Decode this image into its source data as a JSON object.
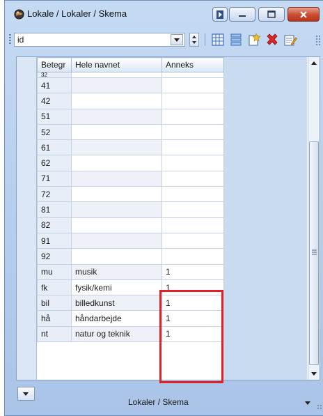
{
  "window": {
    "title": "Lokale / Lokaler / Skema"
  },
  "toolbar": {
    "field_value": "id",
    "icons": [
      "grid-icon",
      "list-icon",
      "new-record-icon",
      "delete-icon",
      "edit-icon"
    ]
  },
  "grid": {
    "columns": [
      "Betegr",
      "Hele navnet",
      "Anneks"
    ],
    "partial_row_code": "32",
    "rows": [
      {
        "code": "41",
        "name": "",
        "annex": ""
      },
      {
        "code": "42",
        "name": "",
        "annex": ""
      },
      {
        "code": "51",
        "name": "",
        "annex": ""
      },
      {
        "code": "52",
        "name": "",
        "annex": ""
      },
      {
        "code": "61",
        "name": "",
        "annex": ""
      },
      {
        "code": "62",
        "name": "",
        "annex": ""
      },
      {
        "code": "71",
        "name": "",
        "annex": ""
      },
      {
        "code": "72",
        "name": "",
        "annex": ""
      },
      {
        "code": "81",
        "name": "",
        "annex": ""
      },
      {
        "code": "82",
        "name": "",
        "annex": ""
      },
      {
        "code": "91",
        "name": "",
        "annex": ""
      },
      {
        "code": "92",
        "name": "",
        "annex": ""
      },
      {
        "code": "mu",
        "name": "musik",
        "annex": "1"
      },
      {
        "code": "fk",
        "name": "fysik/kemi",
        "annex": "1"
      },
      {
        "code": "bil",
        "name": "billedkunst",
        "annex": "1"
      },
      {
        "code": "hå",
        "name": "håndarbejde",
        "annex": "1"
      },
      {
        "code": "nt",
        "name": "natur og teknik",
        "annex": "1"
      }
    ]
  },
  "footer": {
    "view_label": "Lokaler / Skema"
  },
  "colors": {
    "highlight": "#e22126",
    "close_button": "#c94b30",
    "frame": "#a9c4e8"
  }
}
